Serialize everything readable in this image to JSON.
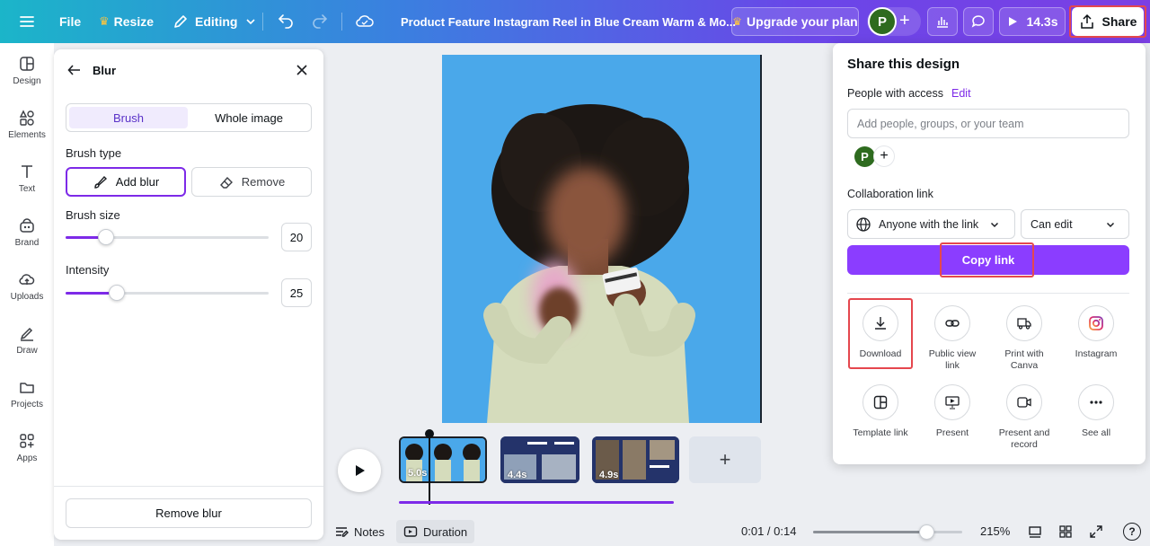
{
  "topbar": {
    "file": "File",
    "resize": "Resize",
    "editing": "Editing",
    "title": "Product Feature Instagram Reel in Blue Cream Warm & Mo...",
    "upgrade": "Upgrade your plan",
    "avatar_initial": "P",
    "duration": "14.3s",
    "share": "Share"
  },
  "rail": {
    "items": [
      {
        "label": "Design",
        "icon": "layout-icon"
      },
      {
        "label": "Elements",
        "icon": "shapes-icon"
      },
      {
        "label": "Text",
        "icon": "text-icon"
      },
      {
        "label": "Brand",
        "icon": "brand-icon"
      },
      {
        "label": "Uploads",
        "icon": "cloud-upload-icon"
      },
      {
        "label": "Draw",
        "icon": "draw-icon"
      },
      {
        "label": "Projects",
        "icon": "folder-icon"
      },
      {
        "label": "Apps",
        "icon": "apps-icon"
      }
    ]
  },
  "blur_panel": {
    "title": "Blur",
    "tab_brush": "Brush",
    "tab_whole": "Whole image",
    "brush_type_label": "Brush type",
    "add_blur": "Add blur",
    "remove": "Remove",
    "brush_size_label": "Brush size",
    "brush_size_value": "20",
    "brush_size_fraction": 0.2,
    "intensity_label": "Intensity",
    "intensity_value": "25",
    "intensity_fraction": 0.25,
    "remove_blur": "Remove blur"
  },
  "timeline": {
    "clips": [
      {
        "duration": "5.0s"
      },
      {
        "duration": "4.4s"
      },
      {
        "duration": "4.9s"
      }
    ],
    "add": "+"
  },
  "bottombar": {
    "notes": "Notes",
    "duration": "Duration",
    "time": "0:01 / 0:14",
    "zoom": "215%",
    "help": "?"
  },
  "share": {
    "title": "Share this design",
    "people_label": "People with access",
    "edit": "Edit",
    "add_placeholder": "Add people, groups, or your team",
    "avatar_initial": "P",
    "collab_label": "Collaboration link",
    "access_value": "Anyone with the link",
    "permission_value": "Can edit",
    "copy_link": "Copy link",
    "options": [
      {
        "label": "Download",
        "icon": "download-icon"
      },
      {
        "label": "Public view link",
        "icon": "link-icon"
      },
      {
        "label": "Print with Canva",
        "icon": "truck-icon"
      },
      {
        "label": "Instagram",
        "icon": "instagram-icon"
      },
      {
        "label": "Template link",
        "icon": "template-icon"
      },
      {
        "label": "Present",
        "icon": "present-icon"
      },
      {
        "label": "Present and record",
        "icon": "record-icon"
      },
      {
        "label": "See all",
        "icon": "more-icon"
      }
    ]
  },
  "colors": {
    "accent": "#8b3dff",
    "highlight": "#e5474e"
  }
}
